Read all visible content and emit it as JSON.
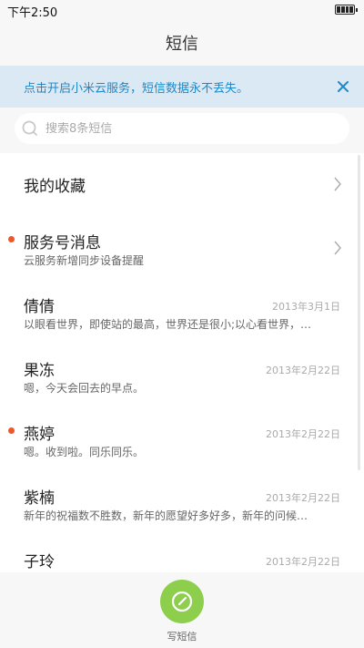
{
  "status_bar": {
    "time": "下午2:50"
  },
  "header": {
    "title": "短信"
  },
  "banner": {
    "text": "点击开启小米云服务，短信数据永不丢失。",
    "close_icon": "close-icon"
  },
  "search": {
    "placeholder": "搜索8条短信"
  },
  "list": {
    "items": [
      {
        "name": "我的收藏",
        "type": "folder",
        "unread": false
      },
      {
        "name": "服务号消息",
        "preview": "云服务新增同步设备提醒",
        "type": "folder",
        "unread": true
      },
      {
        "name": "倩倩",
        "preview": "以眼看世界，即使站的最高，世界还是很小;以心看世界，…",
        "date": "2013年3月1日",
        "unread": false
      },
      {
        "name": "果冻",
        "preview": "嗯，今天会回去的早点。",
        "date": "2013年2月22日",
        "unread": false
      },
      {
        "name": "燕婷",
        "preview": "嗯。收到啦。同乐同乐。",
        "date": "2013年2月22日",
        "unread": true
      },
      {
        "name": "紫楠",
        "preview": "新年的祝福数不胜数，新年的愿望好多好多，新年的问候…",
        "date": "2013年2月22日",
        "unread": false
      },
      {
        "name": "子玲",
        "date": "2013年2月22日",
        "unread": false
      }
    ]
  },
  "compose": {
    "label": "写短信",
    "icon": "compose-icon"
  },
  "colors": {
    "accent": "#1e88c8",
    "unread_dot": "#f0562a",
    "compose_bg": "#8dce4d",
    "banner_bg": "#dbe9f5"
  }
}
